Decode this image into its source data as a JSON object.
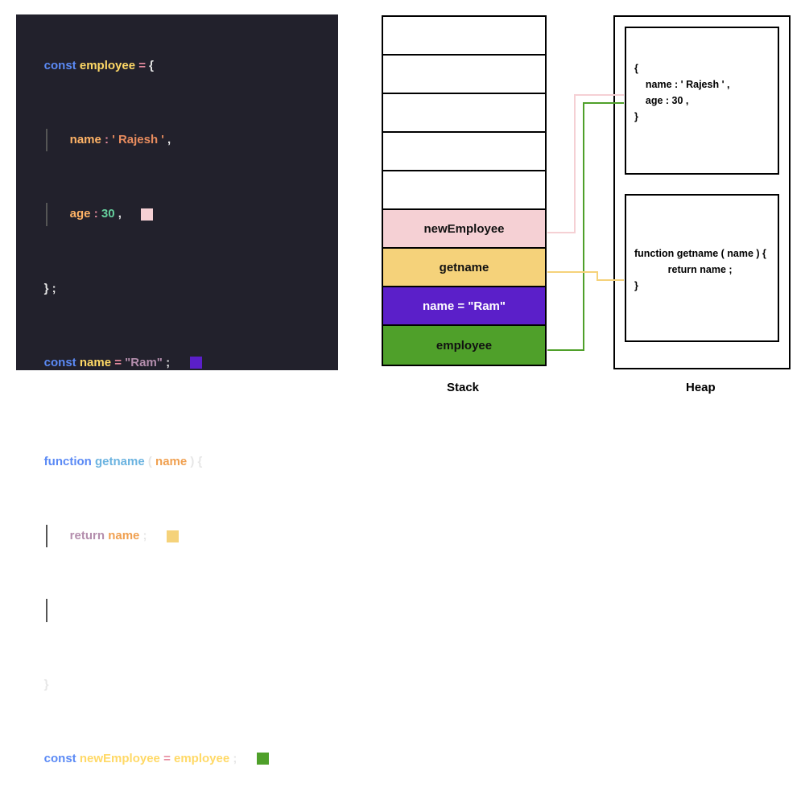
{
  "code": {
    "l1_const": "const ",
    "l1_var": "employee ",
    "l1_eq": "= ",
    "l1_brace": "{",
    "l2_key": "name ",
    "l2_colon": ": ",
    "l2_val": "' Rajesh ' ",
    "l2_comma": ",",
    "l3_key": "age ",
    "l3_colon": ": ",
    "l3_val": "30 ",
    "l3_comma": ",   ",
    "l4_close": "} ;",
    "l5_const": "const ",
    "l5_var": "name ",
    "l5_eq": "= ",
    "l5_val": "\"Ram\" ",
    "l5_semi": ";   ",
    "l7_fn": "function ",
    "l7_name": "getname ",
    "l7_paren1": "( ",
    "l7_arg": "name ",
    "l7_paren2": ") {",
    "l8_return": "return ",
    "l8_name": "name ",
    "l8_semi": ";   ",
    "l10_close": "}",
    "l11_const": "const ",
    "l11_var": "newEmployee ",
    "l11_eq": "= ",
    "l11_val": "employee ",
    "l11_semi": ";   "
  },
  "swatches": {
    "pink": "#f5d0d4",
    "purple": "#5b1fc9",
    "yellow": "#f5d27a",
    "green": "#4fa02a"
  },
  "stack": {
    "label": "Stack",
    "slots": [
      "",
      "",
      "",
      "",
      "",
      "newEmployee",
      "getname",
      "name = \"Ram\"",
      "employee"
    ],
    "colors": {
      "newEmployee": "#f5d0d4",
      "getname": "#f5d27a",
      "name": "#5b1fc9",
      "employee": "#4fa02a"
    }
  },
  "heap": {
    "label": "Heap",
    "obj": {
      "l1": "{",
      "l2": "    name : ' Rajesh ' ,",
      "l3": "    age : 30 ,",
      "l4": "}"
    },
    "fn": {
      "l1": "function getname ( name ) {",
      "l2": "            return name ;",
      "l3": "}"
    }
  },
  "connectors": {
    "green": "#4fa02a",
    "pink": "#f5d0d4",
    "yellow": "#f5d27a"
  }
}
